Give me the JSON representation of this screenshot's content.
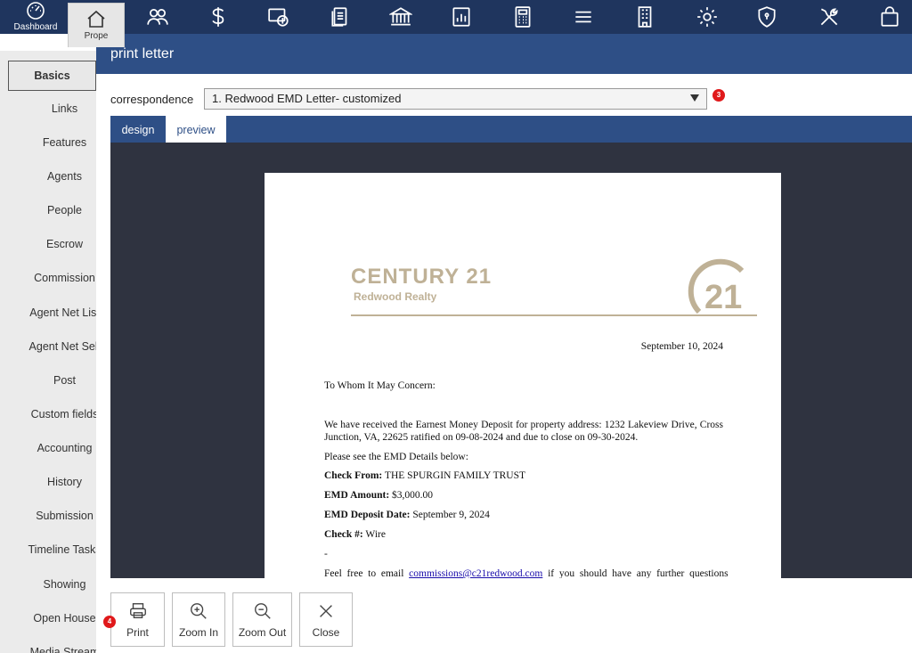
{
  "topnav": {
    "items": [
      {
        "icon": "dashboard-gauge-icon",
        "label": "Dashboard"
      },
      {
        "icon": "home-icon",
        "label": "Prope"
      },
      {
        "icon": "people-icon"
      },
      {
        "icon": "dollar-icon"
      },
      {
        "icon": "money-receipt-icon"
      },
      {
        "icon": "documents-icon"
      },
      {
        "icon": "bank-icon"
      },
      {
        "icon": "bar-chart-icon"
      },
      {
        "icon": "calculator-icon"
      },
      {
        "icon": "menu-icon"
      },
      {
        "icon": "building-icon"
      },
      {
        "icon": "gear-icon"
      },
      {
        "icon": "shield-icon"
      },
      {
        "icon": "tools-icon"
      },
      {
        "icon": "shopping-bag-icon"
      }
    ]
  },
  "sidebar": {
    "items": [
      {
        "label": "Basics"
      },
      {
        "label": "Links"
      },
      {
        "label": "Features"
      },
      {
        "label": "Agents"
      },
      {
        "label": "People"
      },
      {
        "label": "Escrow"
      },
      {
        "label": "Commission"
      },
      {
        "label": "Agent Net List"
      },
      {
        "label": "Agent Net Sell"
      },
      {
        "label": "Post"
      },
      {
        "label": "Custom fields"
      },
      {
        "label": "Accounting"
      },
      {
        "label": "History"
      },
      {
        "label": "Submission"
      },
      {
        "label": "Timeline Tasks"
      },
      {
        "label": "Showing"
      },
      {
        "label": "Open House"
      },
      {
        "label": "Media Stream"
      }
    ]
  },
  "modal": {
    "title": "print letter",
    "correspondence_label": "correspondence",
    "correspondence_value": "1. Redwood EMD Letter- customized",
    "badge_select": "3",
    "badge_print": "4",
    "tabs": {
      "design": "design",
      "preview": "preview"
    },
    "buttons": {
      "print": "Print",
      "zoom_in": "Zoom In",
      "zoom_out": "Zoom Out",
      "close": "Close"
    }
  },
  "letter": {
    "logo_brand": "CENTURY 21",
    "logo_sub": "Redwood Realty",
    "logo_seal": "21",
    "date": "September 10, 2024",
    "salutation": "To Whom It May Concern:",
    "paragraph1": "We have received the Earnest Money Deposit for property address:  1232 Lakeview Drive, Cross Junction, VA, 22625 ratified on 09-08-2024 and due to close on 09-30-2024.",
    "paragraph2": "Please see the EMD Details below:",
    "check_from_label": "Check From:",
    "check_from_value": " THE SPURGIN FAMILY TRUST",
    "emd_amount_label": "EMD Amount:",
    "emd_amount_value": " $3,000.00",
    "emd_date_label": "EMD Deposit Date:",
    "emd_date_value": " September 9, 2024",
    "check_no_label": "Check #:",
    "check_no_value": " Wire",
    "dash": "-",
    "closing_pre": "Feel  free  to  email  ",
    "closing_email": "commissions@c21redwood.com",
    "closing_post": "  if  you  should  have  any  further  questions"
  },
  "colors": {
    "nav": "#1f355e",
    "header": "#2e4f86",
    "viewer": "#2f3340",
    "gold": "#bfb196",
    "badge": "#e0191b"
  }
}
